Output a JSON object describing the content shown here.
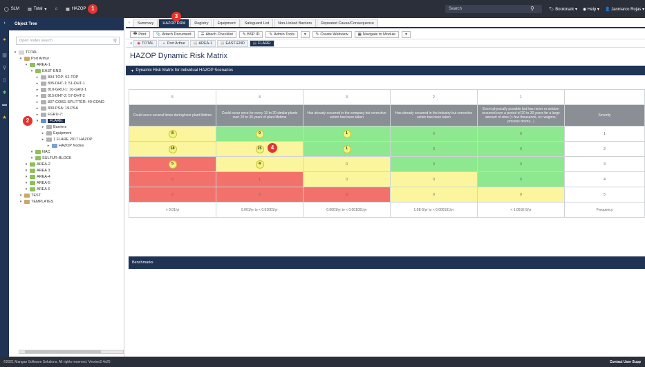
{
  "topbar": {
    "app": "SLM",
    "total": "Total",
    "hazop": "HAZOP",
    "search_placeholder": "Search",
    "bookmark": "Bookmark",
    "help": "Help",
    "user": "Janmarco Rojas",
    "callout1": "1"
  },
  "tree": {
    "title": "Object Tree",
    "search_placeholder": "Open nodes search",
    "callout2": "2",
    "rows": [
      {
        "label": "TOTAL",
        "indent": 0
      },
      {
        "label": "Port Arthur",
        "indent": 1
      },
      {
        "label": "AREA-1",
        "indent": 2
      },
      {
        "label": "EAST-END",
        "indent": 3
      },
      {
        "label": "804-TOP: 62-TOP",
        "indent": 4
      },
      {
        "label": "805-DHT-1: 51-DHT-1",
        "indent": 4
      },
      {
        "label": "810-GRU-1: 10-GRU-1",
        "indent": 4
      },
      {
        "label": "815-DHT-2: 57-DHT-2",
        "indent": 4
      },
      {
        "label": "837-COKE-SPLITTER: 40-COND",
        "indent": 4
      },
      {
        "label": "800-PSA: 19-PSA",
        "indent": 4
      },
      {
        "label": "FGRU-7:",
        "indent": 4
      },
      {
        "label": "FLARE:",
        "indent": 4,
        "selected": true
      },
      {
        "label": "Barriers",
        "indent": 5
      },
      {
        "label": "Equipment",
        "indent": 5
      },
      {
        "label": "1 FLARE 2017 HAZOP",
        "indent": 5
      },
      {
        "label": "HAZOP Nodes",
        "indent": 6
      },
      {
        "label": "NAC",
        "indent": 3
      },
      {
        "label": "SULFUR-BLOCK",
        "indent": 3
      },
      {
        "label": "AREA-2",
        "indent": 2
      },
      {
        "label": "AREA 3",
        "indent": 2
      },
      {
        "label": "AREA-4",
        "indent": 2
      },
      {
        "label": "AREA-5",
        "indent": 2
      },
      {
        "label": "AREA 6",
        "indent": 2
      },
      {
        "label": "TEST",
        "indent": 1
      },
      {
        "label": "TEMPLATES",
        "indent": 1
      }
    ]
  },
  "tabs": [
    "Summary",
    "HAZOP DRM",
    "Registry",
    "Equipment",
    "Safeguard List",
    "Non-Linked Barriers",
    "Repeated Cause/Consequence"
  ],
  "callout3": "3",
  "toolbar": [
    "Print",
    "Attach Document",
    "Attach Checklist",
    "BSP ID",
    "Admin Tools",
    "Create Webview",
    "Navigate to Module"
  ],
  "breadcrumb": [
    "TOTAL",
    "Port Arthur",
    "AREA-1",
    "EAST-END",
    "FLARE:"
  ],
  "page_title": "HAZOP Dynamic Risk Matrix",
  "section_title": "Dynamic Risk Matrix for individual HAZOP Scenarios",
  "matrix": {
    "col_nums": [
      "5",
      "4",
      "3",
      "2",
      "1"
    ],
    "col_desc": [
      "Could occur several times during/over plant lifetime",
      "Could occur once for every 10 to 20 similar plants over 20 to 30 years of plant lifetime",
      "Has already occurred in the company but corrective action has been taken",
      "Has already occurred in the industry but corrective action has been taken",
      "Event physically possible but has never or seldom occurred over a period of 20 to 30 years for a large amount of sites (> few thousands, ex: wagons, process drums...)"
    ],
    "severity_label": "Severity",
    "rows": [
      {
        "cells": [
          {
            "v": "8",
            "c": "y",
            "circ": true
          },
          {
            "v": "9",
            "c": "g",
            "circ": true
          },
          {
            "v": "1",
            "c": "g",
            "circ": true
          },
          {
            "v": "0",
            "c": "g"
          },
          {
            "v": "0",
            "c": "g"
          }
        ],
        "sev": "1"
      },
      {
        "cells": [
          {
            "v": "18",
            "c": "y",
            "circ": true
          },
          {
            "v": "25",
            "c": "y",
            "circ": true
          },
          {
            "v": "1",
            "c": "g",
            "circ": true
          },
          {
            "v": "0",
            "c": "g"
          },
          {
            "v": "0",
            "c": "g"
          }
        ],
        "sev": "2"
      },
      {
        "cells": [
          {
            "v": "5",
            "c": "r",
            "circ": true
          },
          {
            "v": "4",
            "c": "y",
            "circ": true
          },
          {
            "v": "0",
            "c": "y"
          },
          {
            "v": "0",
            "c": "g"
          },
          {
            "v": "0",
            "c": "g"
          }
        ],
        "sev": "3"
      },
      {
        "cells": [
          {
            "v": "0",
            "c": "r"
          },
          {
            "v": "1",
            "c": "r"
          },
          {
            "v": "0",
            "c": "y"
          },
          {
            "v": "0",
            "c": "y"
          },
          {
            "v": "0",
            "c": "g"
          }
        ],
        "sev": "4"
      },
      {
        "cells": [
          {
            "v": "0",
            "c": "r"
          },
          {
            "v": "0",
            "c": "r"
          },
          {
            "v": "0",
            "c": "r"
          },
          {
            "v": "0",
            "c": "y"
          },
          {
            "v": "0",
            "c": "y"
          }
        ],
        "sev": "5"
      }
    ],
    "freq": [
      "> 0.01/yr",
      "0.001/yr to < 0.01001/yr",
      "0.0001/yr to < 0.001001/yr",
      "1.0E-5/yr to < 0.000101/yr",
      "< 1.001E-5/yr"
    ],
    "freq_label": "Frequency",
    "callout4": "4"
  },
  "benchmarks": "Benchmarks",
  "footer": {
    "left": "©2021 Mangan Software Solutions. All rights reserved. Version2.4e25",
    "right": "Contact User Supp"
  }
}
